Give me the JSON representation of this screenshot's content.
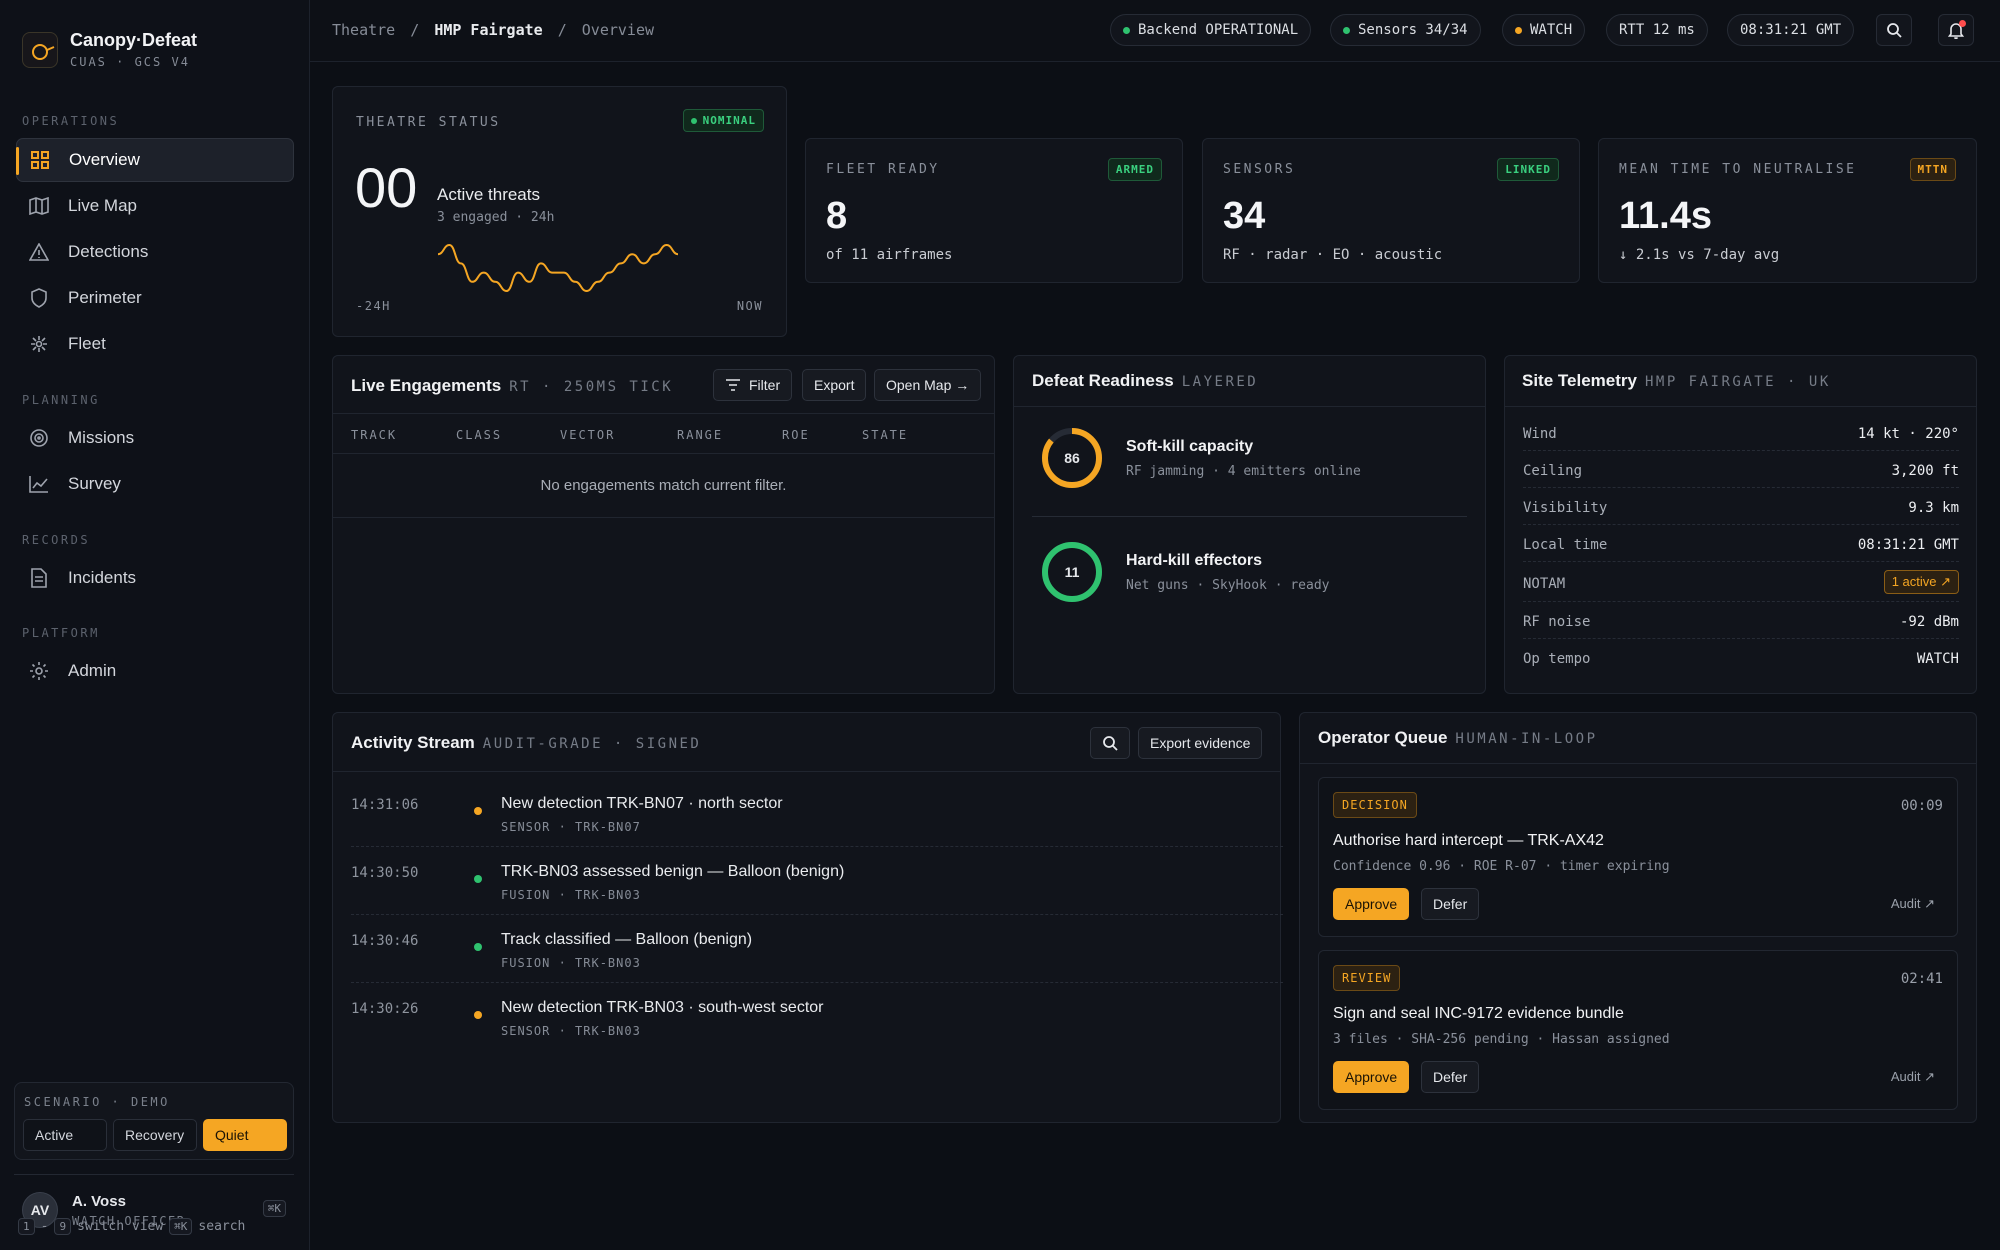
{
  "brand": {
    "name": "Canopy·Defeat",
    "sub": "CUAS · GCS V4"
  },
  "nav": {
    "operations_label": "OPERATIONS",
    "planning_label": "PLANNING",
    "records_label": "RECORDS",
    "platform_label": "PLATFORM",
    "items": [
      {
        "label": "Overview",
        "icon": "grid-icon"
      },
      {
        "label": "Live Map",
        "icon": "map-icon"
      },
      {
        "label": "Detections",
        "icon": "warning-icon"
      },
      {
        "label": "Perimeter",
        "icon": "shield-icon"
      },
      {
        "label": "Fleet",
        "icon": "drone-icon"
      },
      {
        "label": "Missions",
        "icon": "target-icon"
      },
      {
        "label": "Survey",
        "icon": "chart-icon"
      },
      {
        "label": "Incidents",
        "icon": "document-icon"
      },
      {
        "label": "Admin",
        "icon": "gear-icon"
      }
    ]
  },
  "scenario": {
    "label": "SCENARIO · DEMO",
    "options": [
      "Active",
      "Recovery",
      "Quiet"
    ],
    "selected": "Quiet"
  },
  "user": {
    "initials": "AV",
    "name": "A. Voss",
    "role": "WATCH OFFICER",
    "shortcut": "⌘K"
  },
  "hints": {
    "k1": "1",
    "sep": "-",
    "k2": "9",
    "switch": "switch view",
    "k3": "⌘K",
    "search": "search"
  },
  "breadcrumb": {
    "root": "Theatre",
    "sep": "/",
    "site": "HMP Fairgate",
    "page": "Overview"
  },
  "status": {
    "backend": "Backend OPERATIONAL",
    "sensors": "Sensors 34/34",
    "posture": "WATCH",
    "rtt": "RTT 12 ms",
    "clock": "08:31:21 GMT"
  },
  "colors": {
    "accent": "#f5a623",
    "ok": "#2fc26f"
  },
  "theatre": {
    "label": "THEATRE STATUS",
    "badge": "NOMINAL",
    "count": "00",
    "title": "Active threats",
    "sub": "3 engaged · 24h",
    "start": "-24H",
    "end": "NOW",
    "sparkline": [
      6,
      7,
      5,
      3,
      4,
      3,
      2,
      4,
      3,
      5,
      4,
      4,
      3,
      2,
      3,
      4,
      5,
      6,
      5,
      6,
      7,
      6
    ]
  },
  "kpis": [
    {
      "label": "FLEET READY",
      "badge": "ARMED",
      "value": "8",
      "sub": "of 11 airframes"
    },
    {
      "label": "SENSORS",
      "badge": "LINKED",
      "value": "34",
      "sub": "RF · radar · EO · acoustic"
    },
    {
      "label": "MEAN TIME TO NEUTRALISE",
      "badge": "MTTN",
      "value": "11.4s",
      "sub": "↓ 2.1s vs 7-day avg"
    }
  ],
  "engagements": {
    "title": "Live Engagements",
    "tag": "RT · 250MS TICK",
    "filter": "Filter",
    "export": "Export",
    "open_map": "Open Map →",
    "columns": [
      "TRACK",
      "CLASS",
      "VECTOR",
      "RANGE",
      "ROE",
      "STATE"
    ],
    "empty": "No engagements match current filter."
  },
  "readiness": {
    "title": "Defeat Readiness",
    "tag": "LAYERED",
    "items": [
      {
        "value": "86",
        "pct": 86,
        "title": "Soft-kill capacity",
        "sub": "RF jamming · 4 emitters online",
        "color": "#f5a623"
      },
      {
        "value": "11",
        "pct": 100,
        "title": "Hard-kill effectors",
        "sub": "Net guns · SkyHook · ready",
        "color": "#2fc26f"
      }
    ]
  },
  "telemetry": {
    "title": "Site Telemetry",
    "tag": "HMP FAIRGATE · UK",
    "rows": [
      {
        "k": "Wind",
        "v": "14 kt · 220°"
      },
      {
        "k": "Ceiling",
        "v": "3,200 ft"
      },
      {
        "k": "Visibility",
        "v": "9.3 km"
      },
      {
        "k": "Local time",
        "v": "08:31:21 GMT"
      },
      {
        "k": "NOTAM",
        "v": "1 active ↗"
      },
      {
        "k": "RF noise",
        "v": "-92 dBm"
      },
      {
        "k": "Op tempo",
        "v": "WATCH"
      }
    ]
  },
  "activity": {
    "title": "Activity Stream",
    "tag": "AUDIT-GRADE · SIGNED",
    "export": "Export evidence",
    "events": [
      {
        "time": "14:31:06",
        "title": "New detection TRK-BN07 · north sector",
        "sub": "SENSOR · TRK-BN07",
        "color": "#f5a623"
      },
      {
        "time": "14:30:50",
        "title": "TRK-BN03 assessed benign — Balloon (benign)",
        "sub": "FUSION · TRK-BN03",
        "color": "#2fc26f"
      },
      {
        "time": "14:30:46",
        "title": "Track classified — Balloon (benign)",
        "sub": "FUSION · TRK-BN03",
        "color": "#2fc26f"
      },
      {
        "time": "14:30:26",
        "title": "New detection TRK-BN03 · south-west sector",
        "sub": "SENSOR · TRK-BN03",
        "color": "#f5a623"
      }
    ]
  },
  "queue": {
    "title": "Operator Queue",
    "tag": "HUMAN-IN-LOOP",
    "items": [
      {
        "tag": "DECISION",
        "time": "00:09",
        "title": "Authorise hard intercept — TRK-AX42",
        "sub": "Confidence 0.96 · ROE R-07 · timer expiring",
        "approve": "Approve",
        "defer": "Defer",
        "audit": "Audit ↗"
      },
      {
        "tag": "REVIEW",
        "time": "02:41",
        "title": "Sign and seal INC-9172 evidence bundle",
        "sub": "3 files · SHA-256 pending · Hassan assigned",
        "approve": "Approve",
        "defer": "Defer",
        "audit": "Audit ↗"
      }
    ]
  }
}
